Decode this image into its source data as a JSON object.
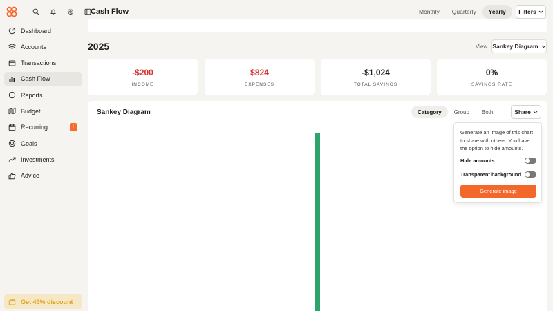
{
  "app": {
    "page_title": "Cash Flow",
    "brand_color": "#f4672b"
  },
  "sidebar": {
    "top_icons": [
      "search-icon",
      "bell-icon",
      "gear-icon",
      "sidebar-toggle-icon"
    ],
    "items": [
      {
        "label": "Dashboard",
        "icon": "dashboard-icon",
        "active": false
      },
      {
        "label": "Accounts",
        "icon": "layers-icon",
        "active": false
      },
      {
        "label": "Transactions",
        "icon": "receipt-icon",
        "active": false
      },
      {
        "label": "Cash Flow",
        "icon": "bar-chart-icon",
        "active": true
      },
      {
        "label": "Reports",
        "icon": "pie-chart-icon",
        "active": false
      },
      {
        "label": "Budget",
        "icon": "map-icon",
        "active": false
      },
      {
        "label": "Recurring",
        "icon": "calendar-icon",
        "active": false,
        "badge": "!"
      },
      {
        "label": "Goals",
        "icon": "target-icon",
        "active": false
      },
      {
        "label": "Investments",
        "icon": "trend-up-icon",
        "active": false
      },
      {
        "label": "Advice",
        "icon": "thumbs-up-icon",
        "active": false
      }
    ],
    "discount_label": "Get 45% discount"
  },
  "header": {
    "period_tabs": [
      {
        "label": "Monthly",
        "active": false
      },
      {
        "label": "Quarterly",
        "active": false
      },
      {
        "label": "Yearly",
        "active": true
      }
    ],
    "filters_label": "Filters"
  },
  "main": {
    "year": "2025",
    "view_label": "View",
    "view_select": "Sankey Diagram",
    "stats": [
      {
        "value": "-$200",
        "label": "INCOME",
        "color": "#d6322f"
      },
      {
        "value": "$824",
        "label": "EXPENSES",
        "color": "#d6322f"
      },
      {
        "value": "-$1,024",
        "label": "TOTAL SAVINGS",
        "color": "#1f1f1f"
      },
      {
        "value": "0%",
        "label": "SAVINGS RATE",
        "color": "#1f1f1f"
      }
    ],
    "sankey": {
      "title": "Sankey Diagram",
      "tabs": [
        {
          "label": "Category",
          "active": true
        },
        {
          "label": "Group",
          "active": false
        },
        {
          "label": "Both",
          "active": false
        }
      ],
      "share_label": "Share",
      "node_color": "#2ca46a"
    }
  },
  "share_popover": {
    "description": "Generate an image of this chart to share with others. You have the option to hide amounts.",
    "hide_amounts_label": "Hide amounts",
    "hide_amounts_on": false,
    "transparent_bg_label": "Transparent background",
    "transparent_bg_on": false,
    "generate_label": "Generate image"
  }
}
